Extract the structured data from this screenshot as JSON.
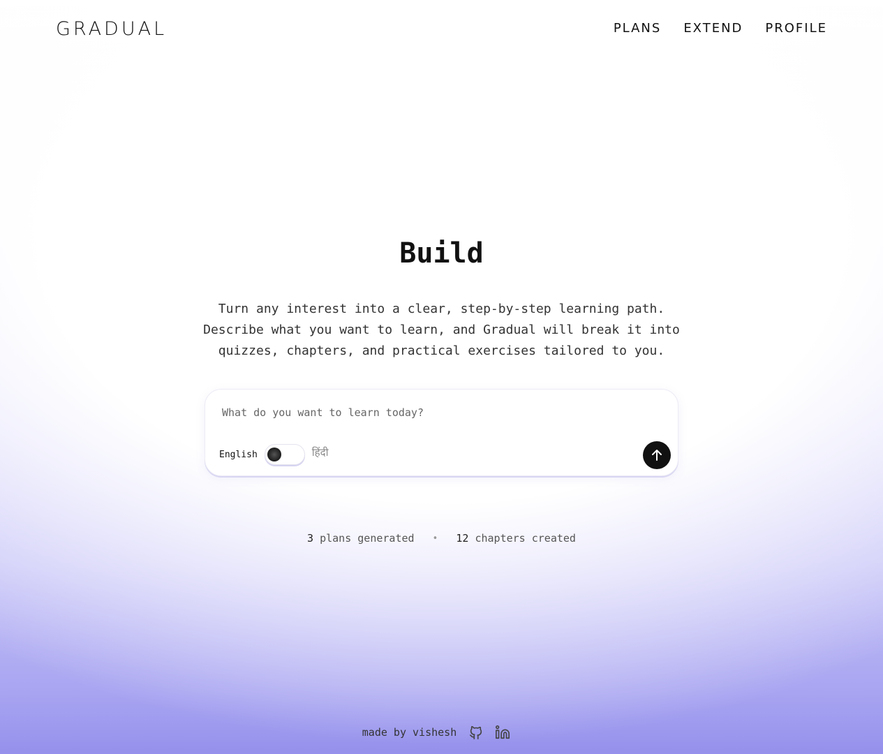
{
  "header": {
    "logo": "GRADUAL",
    "nav": [
      {
        "label": "PLANS"
      },
      {
        "label": "EXTEND"
      },
      {
        "label": "PROFILE"
      }
    ]
  },
  "hero": {
    "title": "Build",
    "subtitle": "Turn any interest into a clear, step-by-step learning path. Describe what you want to learn, and Gradual will break it into quizzes, chapters, and practical exercises tailored to you."
  },
  "prompt": {
    "placeholder": "What do you want to learn today?",
    "value": "",
    "lang_left": "English",
    "lang_right": "हिंदी",
    "selected_language": "English",
    "submit_icon": "arrow-up-icon"
  },
  "stats": {
    "plans_count": "3",
    "plans_label": "plans generated",
    "separator": "•",
    "chapters_count": "12",
    "chapters_label": "chapters created"
  },
  "footer": {
    "made_by": "made by vishesh",
    "icons": [
      "github-icon",
      "linkedin-icon"
    ]
  },
  "colors": {
    "accent_gradient_bottom": "#9591ec",
    "button_bg": "#111111",
    "text": "#1a1a1a"
  }
}
